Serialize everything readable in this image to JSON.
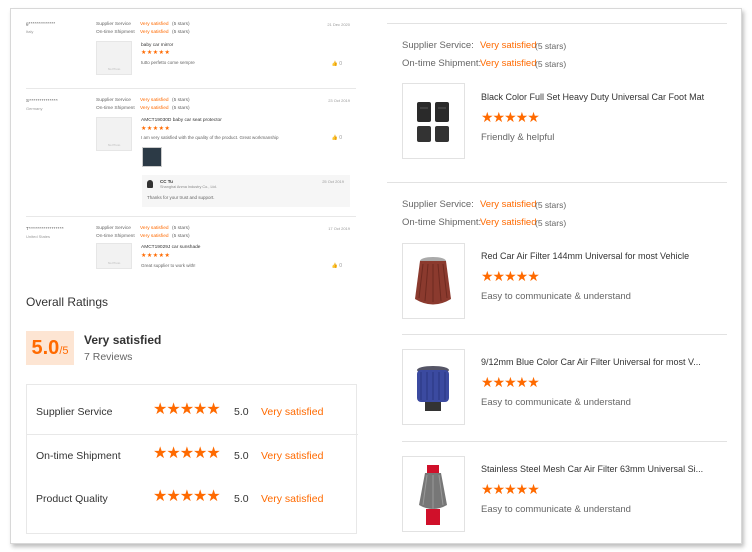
{
  "reviews": [
    {
      "buyer": "g*************",
      "country": "Italy",
      "date": "21 Dec 2020",
      "supplier_service_label": "Supplier Service",
      "supplier_service_value": "Very satisfied",
      "supplier_service_stars": "(5 stars)",
      "shipment_label": "On-time Shipment",
      "shipment_value": "Very satisfied",
      "shipment_stars": "(5 stars)",
      "thumb_text": "No Photo",
      "product": "baby car mirror",
      "text": "tutto perfetto come sempre",
      "likes": "0"
    },
    {
      "buyer": "S**************",
      "country": "Germany",
      "date": "23 Oct 2019",
      "supplier_service_label": "Supplier Service",
      "supplier_service_value": "Very satisfied",
      "supplier_service_stars": "(5 stars)",
      "shipment_label": "On-time Shipment",
      "shipment_value": "Very satisfied",
      "shipment_stars": "(5 stars)",
      "thumb_text": "No Photo",
      "product": "AMCT19030D baby car seat protector",
      "text": "I am very satisfied with the quality of the product. Great workmanship",
      "likes": "0",
      "reply": {
        "name": "CC Tu",
        "company": "Shanghai Anma Industry Co., Ltd.",
        "text": "Thanks for your trust and support.",
        "date": "25 Oct 2019"
      }
    },
    {
      "buyer": "T*****************",
      "country": "United States",
      "date": "17 Oct 2019",
      "supplier_service_label": "Supplier Service",
      "supplier_service_value": "Very satisfied",
      "supplier_service_stars": "(5 stars)",
      "shipment_label": "On-time Shipment",
      "shipment_value": "Very satisfied",
      "shipment_stars": "(5 stars)",
      "thumb_text": "No Photo",
      "product": "AMCT19029J car sunshade",
      "text": "Great supplier to work with!",
      "likes": "0"
    }
  ],
  "overall": {
    "title": "Overall Ratings",
    "score": "5.0",
    "score_max": "/5",
    "label": "Very satisfied",
    "reviews_count": "7 Reviews",
    "rows": [
      {
        "label": "Supplier Service",
        "stars": "★★★★★",
        "rating": 5.0,
        "score": "5.0",
        "text": "Very satisfied"
      },
      {
        "label": "On-time Shipment",
        "stars": "★★★★★",
        "rating": 5.0,
        "score": "5.0",
        "text": "Very satisfied"
      },
      {
        "label": "Product Quality",
        "stars": "★★★★★",
        "rating": 5.0,
        "score": "5.0",
        "text": "Very satisfied"
      }
    ]
  },
  "right_reviews": [
    {
      "supplier_service_label": "Supplier Service:",
      "supplier_service_value": "Very satisfied",
      "supplier_service_stars": "(5 stars)",
      "shipment_label": "On-time Shipment:",
      "shipment_value": "Very satisfied",
      "shipment_stars": "(5 stars)",
      "products": [
        {
          "title": "Black Color Full Set Heavy Duty Universal Car Foot Mat",
          "stars": "★★★★★",
          "rating": 5,
          "text": "Friendly & helpful",
          "image": "car-foot-mat-image"
        }
      ]
    },
    {
      "supplier_service_label": "Supplier Service:",
      "supplier_service_value": "Very satisfied",
      "supplier_service_stars": "(5 stars)",
      "shipment_label": "On-time Shipment:",
      "shipment_value": "Very satisfied",
      "shipment_stars": "(5 stars)",
      "products": [
        {
          "title": "Red Car Air Filter 144mm Universal for most Vehicle",
          "stars": "★★★★★",
          "rating": 5,
          "text": "Easy to communicate & understand",
          "image": "red-air-filter-image"
        },
        {
          "title": "9/12mm Blue Color Car Air Filter Universal for most V...",
          "stars": "★★★★★",
          "rating": 5,
          "text": "Easy to communicate & understand",
          "image": "blue-air-filter-image"
        },
        {
          "title": "Stainless Steel Mesh Car Air Filter 63mm Universal Si...",
          "stars": "★★★★★",
          "rating": 5,
          "text": "Easy to communicate & understand",
          "image": "steel-mesh-air-filter-image"
        }
      ]
    }
  ],
  "small_stars": "★★★★★",
  "icons": {
    "like": "thumb-up-icon"
  },
  "colors": {
    "accent": "#ff6a00",
    "score_bg": "#fde5d3"
  }
}
